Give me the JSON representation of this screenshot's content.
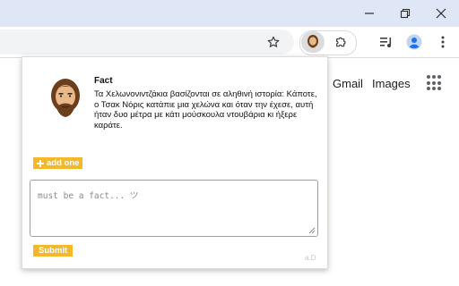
{
  "window_controls": {
    "minimize": "minimize-icon",
    "restore": "restore-icon",
    "close": "close-icon"
  },
  "toolbar": {
    "bookmark_icon": "star-icon",
    "extension_icon": "chuck-norris-icon",
    "extensions_icon": "puzzle-icon",
    "media_icon": "media-control-icon",
    "profile_icon": "profile-icon",
    "menu_icon": "kebab-menu-icon"
  },
  "google_page": {
    "links": [
      "Gmail",
      "Images"
    ],
    "apps_icon": "apps-grid-icon"
  },
  "popup": {
    "title": "Fact",
    "fact": "Τα Χελωνονιντζάκια βασίζονται σε αληθινή ιστορία: Κάποτε, ο Τσακ Νόρις κατάπιε μια χελώνα και όταν την έχεσε, αυτή ήταν δυο μέτρα με κάτι μούσκουλα ντουβάρια κι ήξερε καράτε.",
    "add_label": "add one",
    "input_placeholder": "must be a fact...  ツ",
    "input_value": "",
    "submit_label": "Submit",
    "corner_text": "a.D",
    "accent_color": "#f3b92a"
  }
}
